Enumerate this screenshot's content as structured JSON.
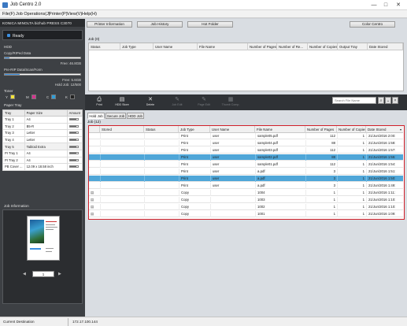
{
  "window": {
    "title": "Job Centro 2.0",
    "minimize": "—",
    "maximize": "□",
    "close": "✕"
  },
  "menu": [
    "File(F)",
    "Job Operations(J)",
    "Printer(P)",
    "View(V)",
    "Help(H)"
  ],
  "left": {
    "brand": "KONICA MINOLTA bizhub PRESS C3070",
    "status": "Ready",
    "hdd": {
      "title": "HDD",
      "copy_label": "Copy/RIPed Data",
      "copy_free": "Free: 46.8GB",
      "prerip_label": "Pre-RIP Data/Scan/Form",
      "prerip_free": "Free: 5.6GB",
      "hold_job": "Hold Job: 12/500",
      "copy_used_fraction": 0.06,
      "prerip_used_fraction": 0.2
    },
    "toner": {
      "title": "Toner",
      "items": [
        {
          "name": "Y",
          "color": "#f3e33a"
        },
        {
          "name": "M",
          "color": "#d6328f"
        },
        {
          "name": "C",
          "color": "#2f9ed8"
        },
        {
          "name": "K",
          "color": "#222222"
        }
      ]
    },
    "paper_tray": {
      "title": "Paper Tray",
      "headers": [
        "Tray",
        "Paper Size",
        "Amount"
      ],
      "rows": [
        {
          "tray": "Tray 1",
          "size": "A4"
        },
        {
          "tray": "Tray 2",
          "size": "B5-R"
        },
        {
          "tray": "Tray 3",
          "size": "Letter"
        },
        {
          "tray": "Tray 4",
          "size": "Letter"
        },
        {
          "tray": "Tray 5",
          "size": "Tabloid Extra"
        },
        {
          "tray": "PI Tray 1",
          "size": "A4"
        },
        {
          "tray": "PI Tray 2",
          "size": "A4"
        },
        {
          "tray": "PB Cover ...",
          "size": "12.09 x 18.58 inch"
        }
      ]
    },
    "job_info": {
      "title": "Job Information",
      "page": "1"
    }
  },
  "top_tabs": [
    "Printer Information",
    "Job History",
    "Hot Folder",
    "Color Centro"
  ],
  "active_jobs": {
    "title": "Job (0)",
    "headers": [
      "Status",
      "Job Type",
      "User Name",
      "File Name",
      "Number of Pages",
      "Number of Re...",
      "Number of Copies",
      "Output Tray",
      "Date Stored"
    ]
  },
  "toolbar": {
    "buttons": [
      "Print",
      "HDD Store",
      "Delete",
      "Job Edit",
      "Page Edit",
      "Thumb Comp."
    ],
    "search_placeholder": "Search File Name"
  },
  "subtabs": [
    "Hold Job",
    "Secure Job",
    "HDD Job"
  ],
  "hold": {
    "title": "Job (12)",
    "headers": [
      "Stored",
      "Status",
      "Job Type",
      "User Name",
      "File Name",
      "Number of Pages",
      "Number of Copies",
      "Date Stored"
    ],
    "rows": [
      {
        "type": "Print",
        "user": "user",
        "file": "sample05.pdf",
        "pages": "112",
        "copies": "1",
        "date": "21/Jun/2016 2:00:",
        "sel": false
      },
      {
        "type": "Print",
        "user": "user",
        "file": "sample04.pdf",
        "pages": "88",
        "copies": "1",
        "date": "21/Jun/2016 1:58:",
        "sel": false
      },
      {
        "type": "Print",
        "user": "user",
        "file": "sample03.pdf",
        "pages": "112",
        "copies": "1",
        "date": "21/Jun/2016 1:57:",
        "sel": false
      },
      {
        "type": "Print",
        "user": "user",
        "file": "sample02.pdf",
        "pages": "88",
        "copies": "1",
        "date": "21/Jun/2016 1:55:",
        "sel": true
      },
      {
        "type": "Print",
        "user": "user",
        "file": "sample01.pdf",
        "pages": "112",
        "copies": "1",
        "date": "21/Jun/2016 1:54:",
        "sel": false
      },
      {
        "type": "Print",
        "user": "user",
        "file": "a.pdf",
        "pages": "3",
        "copies": "1",
        "date": "21/Jun/2016 1:51:",
        "sel": false
      },
      {
        "type": "Print",
        "user": "user",
        "file": "a.pdf",
        "pages": "3",
        "copies": "1",
        "date": "21/Jun/2016 1:50:",
        "sel": true
      },
      {
        "type": "Print",
        "user": "user",
        "file": "a.pdf",
        "pages": "3",
        "copies": "1",
        "date": "21/Jun/2016 1:49:",
        "sel": false
      },
      {
        "type": "Copy",
        "user": "",
        "file": "1004",
        "pages": "1",
        "copies": "1",
        "date": "21/Jun/2016 1:11:",
        "sel": false
      },
      {
        "type": "Copy",
        "user": "",
        "file": "1003",
        "pages": "1",
        "copies": "1",
        "date": "21/Jun/2016 1:10:",
        "sel": false
      },
      {
        "type": "Copy",
        "user": "",
        "file": "1002",
        "pages": "1",
        "copies": "1",
        "date": "21/Jun/2016 1:10:",
        "sel": false
      },
      {
        "type": "Copy",
        "user": "",
        "file": "1001",
        "pages": "1",
        "copies": "1",
        "date": "21/Jun/2016 1:09:",
        "sel": false
      }
    ]
  },
  "statusbar": {
    "left": "Current Destination",
    "ip": "172.17.100.144"
  }
}
